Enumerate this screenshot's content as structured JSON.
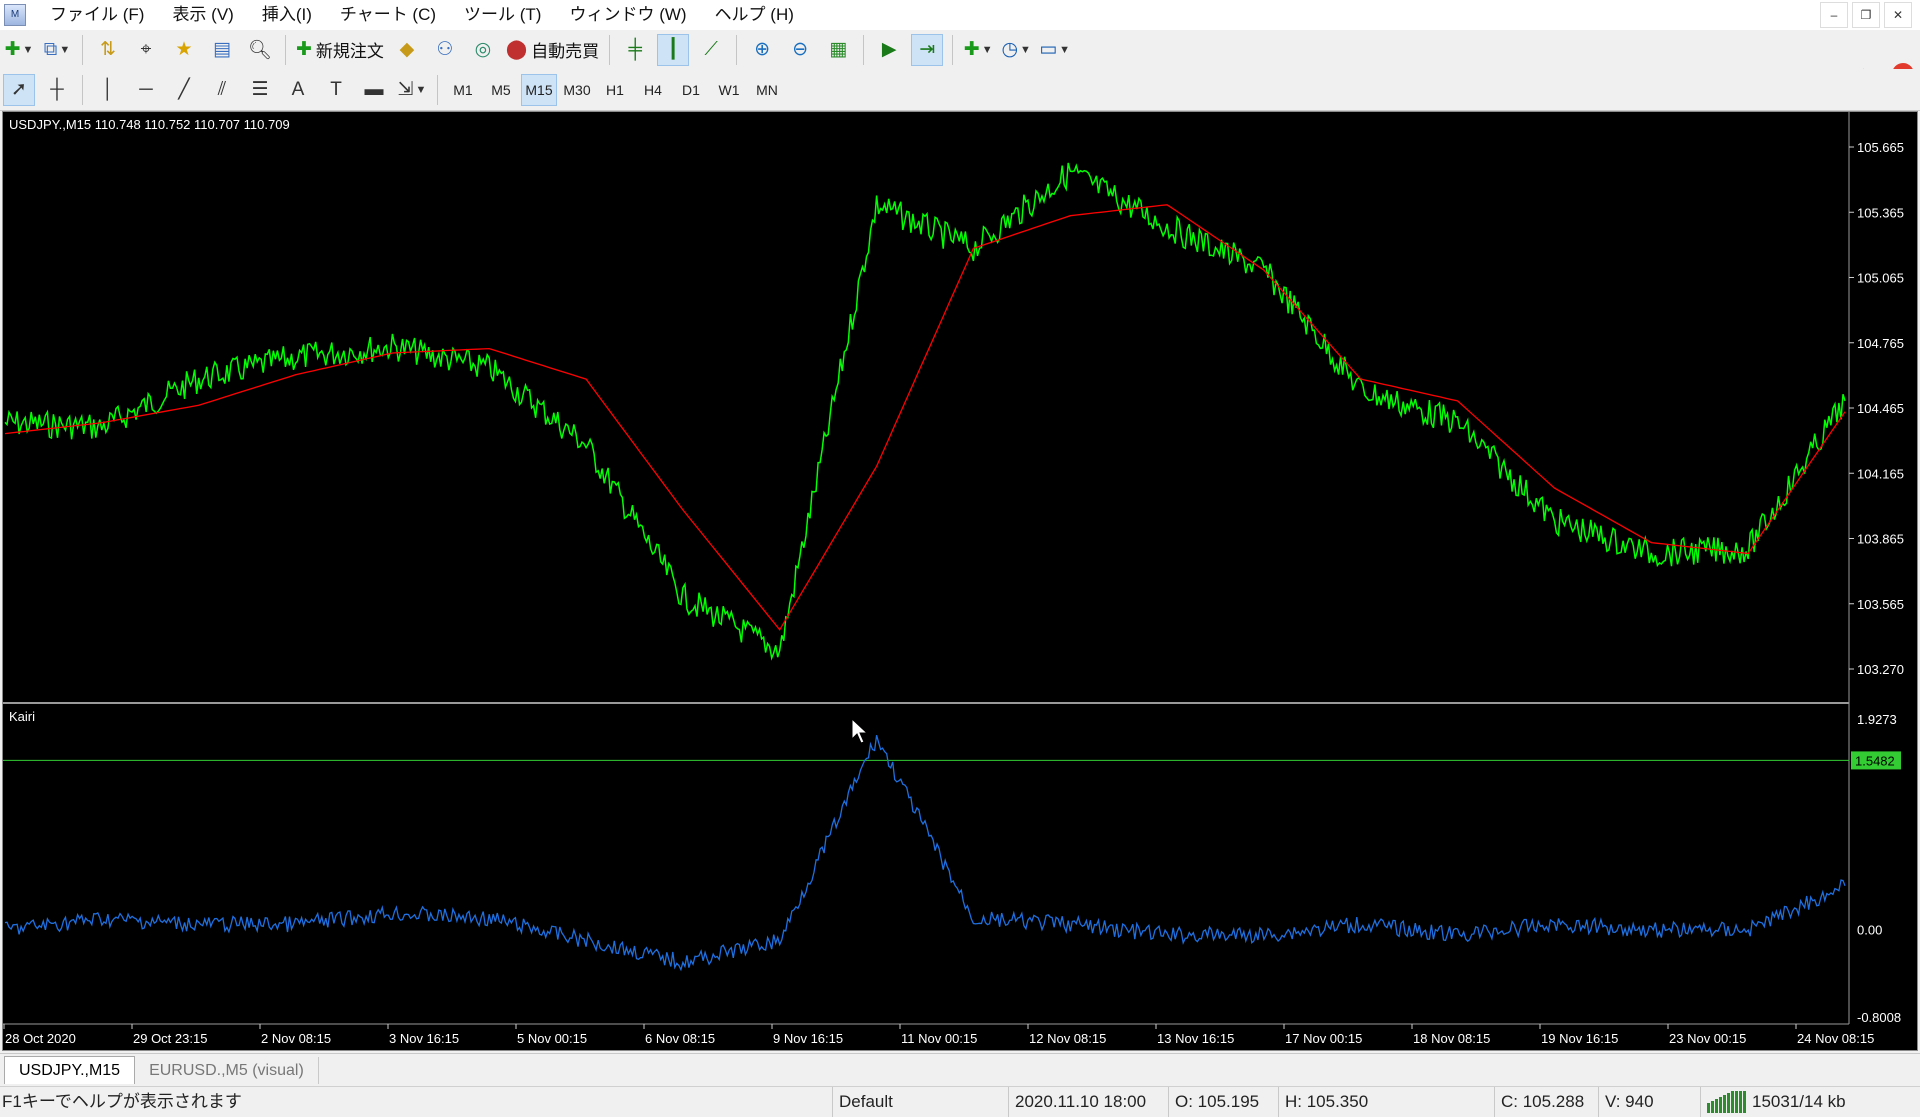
{
  "app": {
    "menu": [
      "ファイル (F)",
      "表示 (V)",
      "挿入(I)",
      "チャート (C)",
      "ツール (T)",
      "ウィンドウ (W)",
      "ヘルプ (H)"
    ],
    "notification_count": "1"
  },
  "toolbar": {
    "new_order": "新規注文",
    "auto_trading": "自動売買"
  },
  "timeframes": [
    "M1",
    "M5",
    "M15",
    "M30",
    "H1",
    "H4",
    "D1",
    "W1",
    "MN"
  ],
  "active_timeframe": "M15",
  "chart": {
    "header": "USDJPY.,M15  110.748 110.752 110.707 110.709",
    "indicator_name": "Kairi",
    "price_axis": [
      "105.665",
      "105.365",
      "105.065",
      "104.765",
      "104.465",
      "104.165",
      "103.865",
      "103.565",
      "103.270"
    ],
    "indicator_axis": [
      "1.9273",
      "0.00",
      "-0.8008"
    ],
    "level_label": "1.5482",
    "time_axis": [
      "28 Oct 2020",
      "29 Oct 23:15",
      "2 Nov 08:15",
      "3 Nov 16:15",
      "5 Nov 00:15",
      "6 Nov 08:15",
      "9 Nov 16:15",
      "11 Nov 00:15",
      "12 Nov 08:15",
      "13 Nov 16:15",
      "17 Nov 00:15",
      "18 Nov 08:15",
      "19 Nov 16:15",
      "23 Nov 00:15",
      "24 Nov 08:15"
    ],
    "colors": {
      "price": "#00ff00",
      "ma": "#ff0000",
      "kairi": "#1e6fe0",
      "level": "#33cc33"
    }
  },
  "chart_data": {
    "type": "line",
    "x": [
      "28 Oct",
      "29 Oct",
      "30 Oct",
      "2 Nov",
      "3 Nov",
      "4 Nov",
      "5 Nov",
      "6 Nov",
      "9 Nov",
      "10 Nov",
      "11 Nov",
      "12 Nov",
      "13 Nov",
      "16 Nov",
      "17 Nov",
      "18 Nov",
      "19 Nov",
      "20 Nov",
      "23 Nov",
      "24 Nov"
    ],
    "series": [
      {
        "values": [
          104.4,
          104.38,
          104.6,
          104.7,
          104.75,
          104.65,
          104.3,
          103.6,
          103.35,
          105.4,
          105.2,
          105.55,
          105.3,
          105.1,
          104.55,
          104.4,
          103.95,
          103.8,
          103.82,
          104.5
        ]
      },
      {
        "values": [
          104.35,
          104.4,
          104.48,
          104.62,
          104.72,
          104.74,
          104.6,
          104.0,
          103.45,
          104.2,
          105.2,
          105.35,
          105.4,
          105.1,
          104.6,
          104.5,
          104.1,
          103.85,
          103.8,
          104.45
        ]
      }
    ],
    "indicator": {
      "name": "Kairi",
      "values": [
        0.0,
        0.1,
        0.05,
        0.05,
        0.15,
        0.1,
        -0.1,
        -0.3,
        -0.1,
        1.75,
        0.1,
        0.05,
        -0.05,
        -0.05,
        0.05,
        -0.05,
        0.05,
        0.0,
        0.0,
        0.4
      ],
      "level": 1.5482,
      "ylim": [
        -0.8008,
        1.9273
      ]
    },
    "ylim": [
      103.27,
      105.665
    ]
  },
  "tabs": [
    "USDJPY.,M15",
    "EURUSD.,M5 (visual)"
  ],
  "status": {
    "help": "F1キーでヘルプが表示されます",
    "profile": "Default",
    "datetime": "2020.11.10 18:00",
    "open": "O: 105.195",
    "high": "H: 105.350",
    "close": "C: 105.288",
    "volume": "V: 940",
    "traffic": "15031/14 kb"
  }
}
